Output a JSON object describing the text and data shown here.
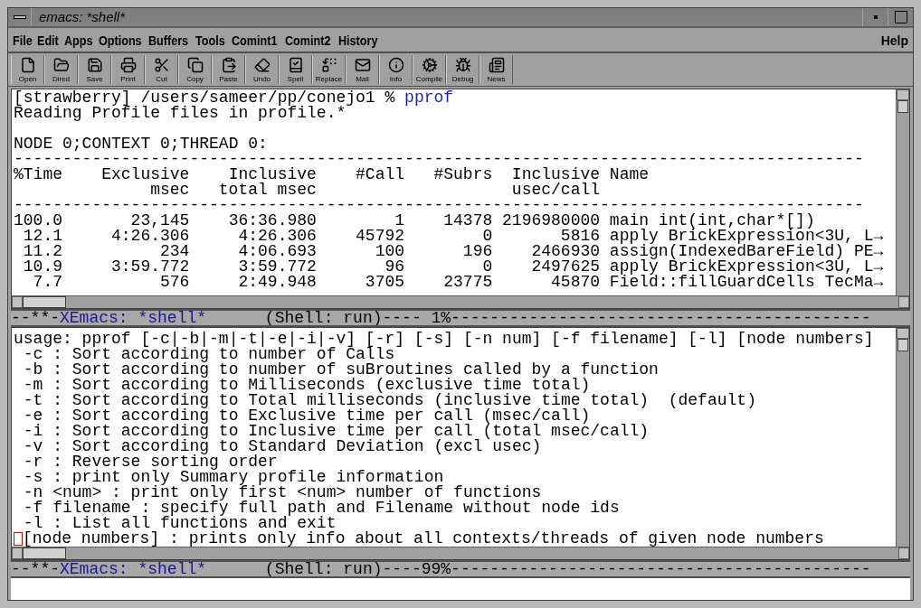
{
  "window": {
    "title": "emacs: *shell*"
  },
  "menu": [
    {
      "label": "File"
    },
    {
      "label": "Edit"
    },
    {
      "label": "Apps"
    },
    {
      "label": "Options"
    },
    {
      "label": "Buffers"
    },
    {
      "label": "Tools"
    },
    {
      "label": "Comint1"
    },
    {
      "label": "Comint2"
    },
    {
      "label": "History"
    }
  ],
  "help": "Help",
  "toolbar": [
    {
      "label": "Open",
      "kind": "open"
    },
    {
      "label": "Dired",
      "kind": "dired"
    },
    {
      "label": "Save",
      "kind": "save"
    },
    {
      "label": "Print",
      "kind": "print"
    },
    {
      "label": "Cut",
      "kind": "cut"
    },
    {
      "label": "Copy",
      "kind": "copy"
    },
    {
      "label": "Paste",
      "kind": "paste"
    },
    {
      "label": "Undo",
      "kind": "undo"
    },
    {
      "label": "Spell",
      "kind": "spell"
    },
    {
      "label": "Replace",
      "kind": "replace"
    },
    {
      "label": "Mail",
      "kind": "mail"
    },
    {
      "label": "Info",
      "kind": "info"
    },
    {
      "label": "Compile",
      "kind": "compile"
    },
    {
      "label": "Debug",
      "kind": "debug"
    },
    {
      "label": "News",
      "kind": "news"
    }
  ],
  "upper_pane": {
    "prompt": "[strawberry] /users/sameer/pp/conejo1 % ",
    "command": "pprof",
    "lines": [
      "Reading Profile files in profile.*"
    ],
    "context_line": "NODE 0;CONTEXT 0;THREAD 0:",
    "rule": "---------------------------------------------------------------------------------------",
    "columns": [
      {
        "label": "%Time"
      },
      {
        "label": "Exclusive",
        "unit": "msec"
      },
      {
        "label": "Inclusive",
        "unit": "total msec"
      },
      {
        "label": "#Call"
      },
      {
        "label": "#Subrs"
      },
      {
        "label": "Inclusive",
        "unit": "usec/call"
      },
      {
        "label": "Name"
      }
    ],
    "truncation_glyph": "→",
    "rows": [
      {
        "cells": [
          "100.0",
          "23,145",
          "36:36.980",
          "1",
          "14378",
          "2196980000",
          "main int(int,char*[])"
        ],
        "truncated": false
      },
      {
        "cells": [
          "12.1",
          "4:26.306",
          "4:26.306",
          "45792",
          "0",
          "5816",
          "apply BrickExpression<3U, L"
        ],
        "truncated": true
      },
      {
        "cells": [
          "11.2",
          "234",
          "4:06.693",
          "100",
          "196",
          "2466930",
          "assign(IndexedBareField) PE"
        ],
        "truncated": true
      },
      {
        "cells": [
          "10.9",
          "3:59.772",
          "3:59.772",
          "96",
          "0",
          "2497625",
          "apply BrickExpression<3U, L"
        ],
        "truncated": true
      },
      {
        "cells": [
          "7.7",
          "576",
          "2:49.948",
          "3705",
          "23775",
          "45870",
          "Field::fillGuardCells TecMa"
        ],
        "truncated": true
      }
    ]
  },
  "upper_modeline": {
    "flags": "--**-",
    "buffer": "XEmacs: *shell*",
    "rest": "      (Shell: run)---- 1%-------------------------------------------"
  },
  "lower_pane": {
    "lines": [
      "usage: pprof [-c|-b|-m|-t|-e|-i|-v] [-r] [-s] [-n num] [-f filename] [-l] [node numbers]",
      " -c : Sort according to number of Calls",
      " -b : Sort according to number of suBroutines called by a function",
      " -m : Sort according to Milliseconds (exclusive time total)",
      " -t : Sort according to Total milliseconds (inclusive time total)  (default)",
      " -e : Sort according to Exclusive time per call (msec/call)",
      " -i : Sort according to Inclusive time per call (total msec/call)",
      " -v : Sort according to Standard Deviation (excl usec)",
      " -r : Reverse sorting order",
      " -s : print only Summary profile information",
      " -n <num> : print only first <num> number of functions",
      " -f filename : specify full path and Filename without node ids",
      " -l : List all functions and exit"
    ],
    "cursor_line": "[node numbers] : prints only info about all contexts/threads of given node numbers"
  },
  "lower_modeline": {
    "flags": "--**-",
    "buffer": "XEmacs: *shell*",
    "rest": "      (Shell: run)----99%-------------------------------------------"
  }
}
